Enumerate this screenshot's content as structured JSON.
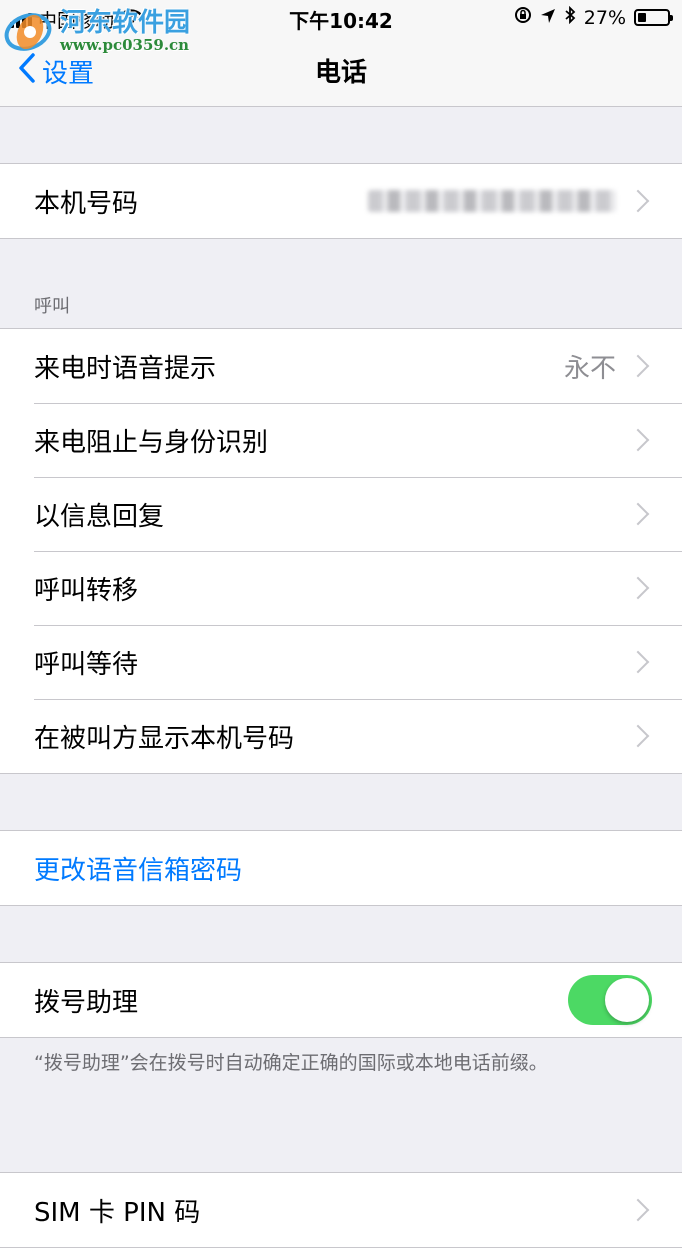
{
  "status_bar": {
    "carrier": "中国移动",
    "time": "下午10:42",
    "battery_percent": "27%",
    "battery_level": 0.27,
    "icons": [
      "signal-icon",
      "wifi-icon",
      "lock-rotation-icon",
      "location-icon",
      "bluetooth-icon",
      "battery-icon"
    ]
  },
  "watermark": {
    "title": "河东软件园",
    "url": "www.pc0359.cn"
  },
  "nav": {
    "back_label": "设置",
    "title": "电话"
  },
  "my_number": {
    "label": "本机号码",
    "value_blurred": true
  },
  "calls_section": {
    "header": "呼叫",
    "items": [
      {
        "label": "来电时语音提示",
        "detail": "永不"
      },
      {
        "label": "来电阻止与身份识别",
        "detail": ""
      },
      {
        "label": "以信息回复",
        "detail": ""
      },
      {
        "label": "呼叫转移",
        "detail": ""
      },
      {
        "label": "呼叫等待",
        "detail": ""
      },
      {
        "label": "在被叫方显示本机号码",
        "detail": ""
      }
    ]
  },
  "voicemail": {
    "label": "更改语音信箱密码"
  },
  "dial_assist": {
    "label": "拨号助理",
    "enabled": true,
    "footer": "“拨号助理”会在拨号时自动确定正确的国际或本地电话前缀。"
  },
  "sim_pin": {
    "label": "SIM 卡 PIN 码"
  },
  "colors": {
    "accent": "#007aff",
    "toggle_on": "#4cd964",
    "background": "#efeff4",
    "secondary_text": "#8e8e93",
    "watermark_blue": "#3aa0e0",
    "watermark_green": "#2c8a3a"
  }
}
